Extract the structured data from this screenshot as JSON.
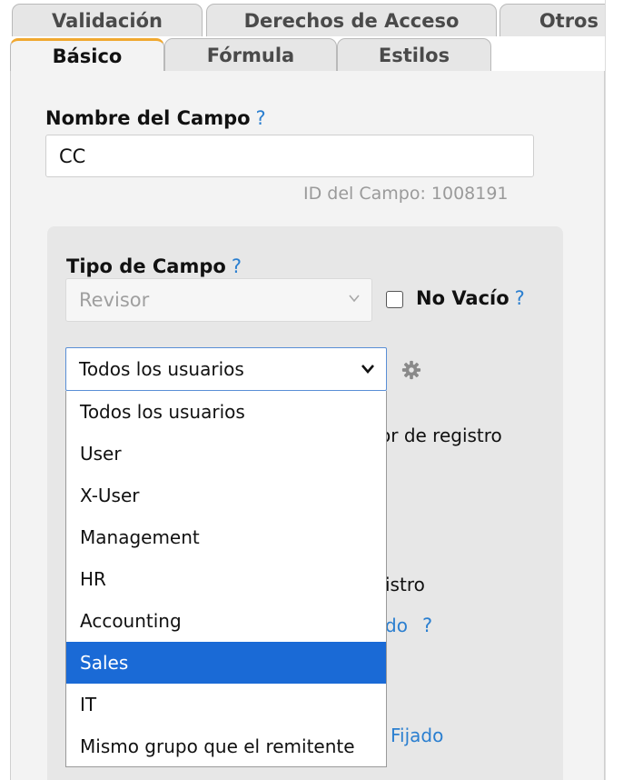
{
  "tabs_back": [
    "Validación",
    "Derechos de Acceso",
    "Otros"
  ],
  "tabs_front": [
    "Básico",
    "Fórmula",
    "Estilos"
  ],
  "field_name": {
    "label": "Nombre del Campo",
    "help": "?",
    "value": "CC",
    "id_text": "ID del Campo: 1008191"
  },
  "field_type": {
    "label": "Tipo de Campo",
    "help": "?",
    "selected": "Revisor"
  },
  "not_empty": {
    "label": "No Vacío",
    "help": "?",
    "checked": false
  },
  "group_select": {
    "selected": "Todos los usuarios",
    "options": [
      "Todos los usuarios",
      "User",
      "X-User",
      "Management",
      "HR",
      "Accounting",
      "Sales",
      "IT",
      "Mismo grupo que el remitente"
    ],
    "highlighted": "Sales"
  },
  "background_fragments": {
    "f1": "or de registro",
    "f2": "istro",
    "f3": "do",
    "f3_help": "?",
    "f4": "Fijado"
  },
  "colors": {
    "accent_tab": "#f0a830",
    "help_blue": "#2b7fd0",
    "selection_blue": "#1a6ad6"
  }
}
